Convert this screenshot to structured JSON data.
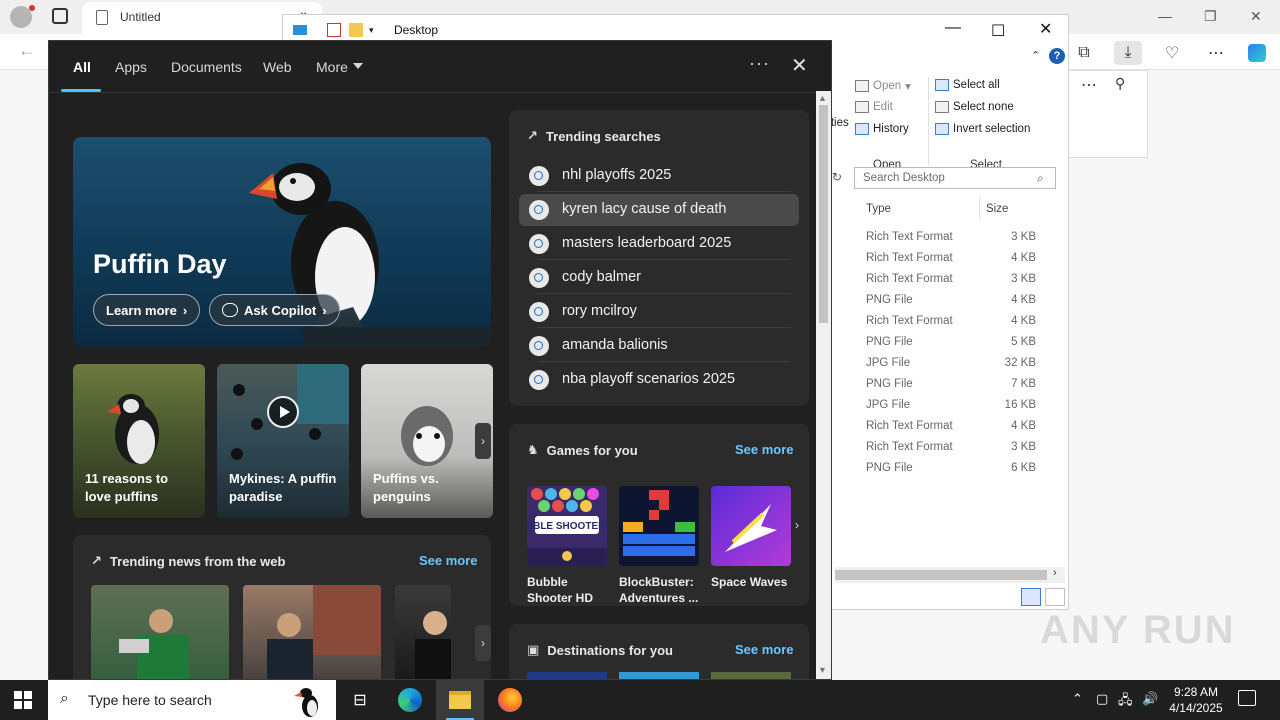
{
  "browser": {
    "tab_title": "Untitled",
    "tab_close": "×",
    "back_glyph": "←"
  },
  "explorer": {
    "title": "Desktop",
    "help": "?",
    "ribbon": {
      "open": "Open",
      "edit": "Edit",
      "history": "History",
      "properties_partial": "rties",
      "select_all": "Select all",
      "select_none": "Select none",
      "invert_selection": "Invert selection",
      "group_open": "Open",
      "group_select": "Select"
    },
    "search_placeholder": "Search Desktop",
    "columns": {
      "type": "Type",
      "size": "Size"
    },
    "files": [
      {
        "type": "Rich Text Format",
        "size": "3 KB"
      },
      {
        "type": "Rich Text Format",
        "size": "4 KB"
      },
      {
        "type": "Rich Text Format",
        "size": "3 KB"
      },
      {
        "type": "PNG File",
        "size": "4 KB"
      },
      {
        "type": "Rich Text Format",
        "size": "4 KB"
      },
      {
        "type": "PNG File",
        "size": "5 KB"
      },
      {
        "type": "JPG File",
        "size": "32 KB"
      },
      {
        "type": "PNG File",
        "size": "7 KB"
      },
      {
        "type": "JPG File",
        "size": "16 KB"
      },
      {
        "type": "Rich Text Format",
        "size": "4 KB"
      },
      {
        "type": "Rich Text Format",
        "size": "3 KB"
      },
      {
        "type": "PNG File",
        "size": "6 KB"
      }
    ]
  },
  "flyout": {
    "tabs": [
      "All",
      "Apps",
      "Documents",
      "Web",
      "More"
    ],
    "more_options": "···",
    "close": "✕",
    "hero": {
      "title": "Puffin Day",
      "learn_more": "Learn more",
      "ask_copilot": "Ask Copilot"
    },
    "cards": [
      {
        "label": "11 reasons to love puffins"
      },
      {
        "label": "Mykines: A puffin paradise"
      },
      {
        "label": "Puffins vs. penguins"
      }
    ],
    "trending_news": {
      "title": "Trending news from the web",
      "see_more": "See more"
    },
    "trending_searches": {
      "title": "Trending searches",
      "items": [
        "nhl playoffs 2025",
        "kyren lacy cause of death",
        "masters leaderboard 2025",
        "cody balmer",
        "rory mcilroy",
        "amanda balionis",
        "nba playoff scenarios 2025"
      ]
    },
    "games": {
      "title": "Games for you",
      "see_more": "See more",
      "items": [
        "Bubble Shooter HD",
        "BlockBuster: Adventures ...",
        "Space Waves"
      ],
      "bubble_logo": "BUBBLE SHOOTER HD"
    },
    "destinations": {
      "title": "Destinations for you",
      "see_more": "See more"
    }
  },
  "taskbar": {
    "search_placeholder": "Type here to search",
    "time": "9:28 AM",
    "date": "4/14/2025"
  },
  "watermark": "ANY RUN",
  "colors": {
    "accent": "#4cc2ff",
    "link": "#6cc6ff",
    "flyout_bg": "#202020",
    "panel_bg": "#2b2b2b",
    "taskbar_bg": "#1f1f1f"
  }
}
